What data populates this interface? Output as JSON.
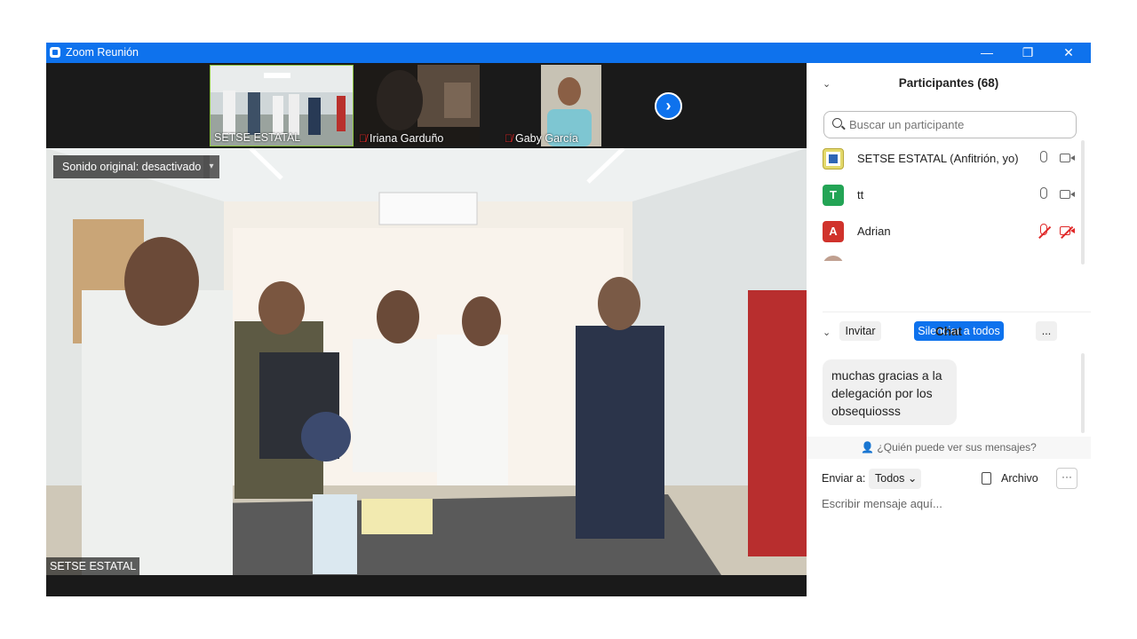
{
  "window": {
    "title": "Zoom Reunión",
    "minimize": "—",
    "restore": "❐",
    "close": "✕"
  },
  "thumbnails": [
    {
      "name": "SETSE ESTATAL",
      "muted": false
    },
    {
      "name": "Iriana Garduño",
      "muted": true
    },
    {
      "name": "Gaby García",
      "muted": true
    }
  ],
  "next_arrow": "›",
  "main_video": {
    "audio_badge": "Sonido original: desactivado",
    "audio_dropdown": "▾",
    "speaker_name": "SETSE ESTATAL"
  },
  "participants": {
    "header": "Participantes (68)",
    "collapse": "⌄",
    "search_placeholder": "Buscar un participante",
    "list": [
      {
        "name": "SETSE ESTATAL (Anfitrión, yo)",
        "avatar": "",
        "avatar_color": "#d8c23a",
        "mic": "on",
        "cam": "on"
      },
      {
        "name": "tt",
        "avatar": "T",
        "avatar_color": "#23a455",
        "mic": "on",
        "cam": "on"
      },
      {
        "name": "Adrian",
        "avatar": "A",
        "avatar_color": "#d0322b",
        "mic": "off",
        "cam": "off"
      }
    ],
    "invite_label": "Invitar",
    "mute_all_label": "Silenciar a todos",
    "more_label": "..."
  },
  "chat": {
    "header": "Chat",
    "collapse": "⌄",
    "messages": [
      {
        "text": "muchas gracias a la delegación por los obsequiosss"
      }
    ],
    "who_can_see": "¿Quién puede ver sus mensajes?",
    "send_to_label": "Enviar a:",
    "send_to_value": "Todos",
    "file_label": "Archivo",
    "more_label": "···",
    "input_placeholder": "Escribir mensaje aquí..."
  },
  "colors": {
    "titlebar": "#0e72ed",
    "accent": "#0e72ed",
    "muted_red": "#e02828"
  }
}
